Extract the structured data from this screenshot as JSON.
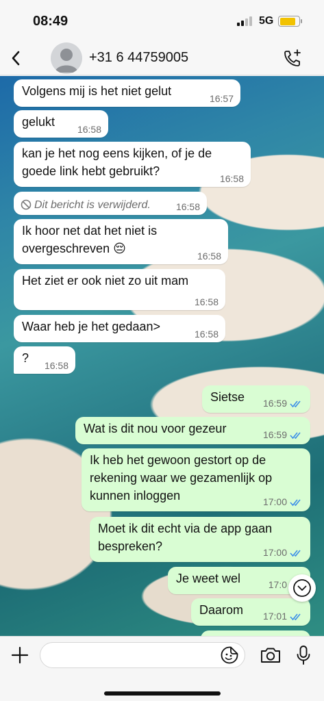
{
  "status_bar": {
    "time": "08:49",
    "network": "5G",
    "battery_level": 0.85,
    "battery_color": "#f2c200"
  },
  "header": {
    "contact_name": "+31 6 44759005",
    "icons": [
      "back-arrow-icon",
      "avatar-icon",
      "add-call-icon"
    ]
  },
  "messages": [
    {
      "dir": "in",
      "text": "Volgens mij is het niet gelut",
      "time": "16:57"
    },
    {
      "dir": "in",
      "text": "gelukt",
      "time": "16:58"
    },
    {
      "dir": "in",
      "text": "kan je het nog eens kijken, of je de goede link hebt gebruikt?",
      "time": "16:58"
    },
    {
      "dir": "in",
      "text": "Dit bericht is verwijderd.",
      "time": "16:58",
      "deleted": true
    },
    {
      "dir": "in",
      "text": "Ik hoor net dat het niet is overgeschreven 😔",
      "time": "16:58"
    },
    {
      "dir": "in",
      "text": "Het ziet er ook niet zo uit mam",
      "time": "16:58"
    },
    {
      "dir": "in",
      "text": "Waar heb je het gedaan>",
      "time": "16:58"
    },
    {
      "dir": "in",
      "text": "?",
      "time": "16:58"
    },
    {
      "dir": "out",
      "text": "Sietse",
      "time": "16:59",
      "read": true
    },
    {
      "dir": "out",
      "text": "Wat is dit nou voor gezeur",
      "time": "16:59",
      "read": true
    },
    {
      "dir": "out",
      "text": "Ik heb het gewoon gestort op de rekening waar we gezamenlijk op kunnen inloggen",
      "time": "17:00",
      "read": true
    },
    {
      "dir": "out",
      "text": "Moet ik dit echt via de app gaan bespreken?",
      "time": "17:00",
      "read": true
    },
    {
      "dir": "out",
      "text": "Je weet wel",
      "time": "17:0",
      "read": true
    },
    {
      "dir": "out",
      "text": "Daarom",
      "time": "17:01",
      "read": true
    }
  ],
  "colors": {
    "incoming_bubble": "#ffffff",
    "outgoing_bubble": "#d9fdd3",
    "read_ticks": "#3b8ee8"
  },
  "input": {
    "placeholder": "",
    "value": ""
  },
  "input_icons": [
    "plus-icon",
    "sticker-icon",
    "camera-icon",
    "microphone-icon"
  ]
}
